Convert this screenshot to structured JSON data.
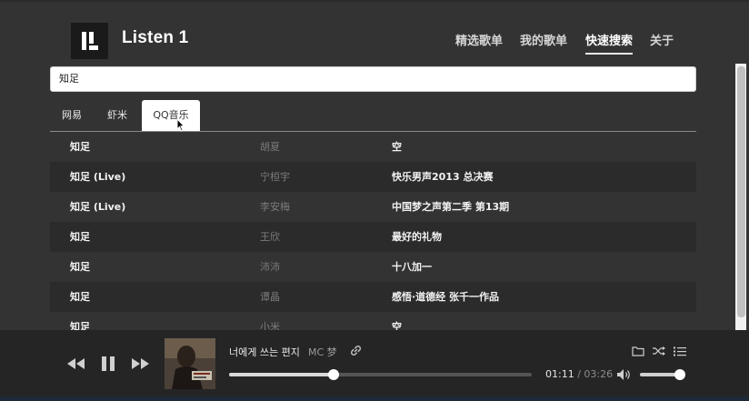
{
  "app": {
    "title": "Listen 1",
    "logo_icon": "listen1-logo-icon"
  },
  "nav": {
    "items": [
      {
        "label": "精选歌单",
        "active": false
      },
      {
        "label": "我的歌单",
        "active": false
      },
      {
        "label": "快速搜索",
        "active": true
      },
      {
        "label": "关于",
        "active": false
      }
    ]
  },
  "search": {
    "value": "知足"
  },
  "source_tabs": [
    {
      "label": "网易",
      "active": false
    },
    {
      "label": "虾米",
      "active": false
    },
    {
      "label": "QQ音乐",
      "active": true
    }
  ],
  "results": [
    {
      "title": "知足",
      "artist": "胡夏",
      "album": "空"
    },
    {
      "title": "知足 (Live)",
      "artist": "宁桓宇",
      "album": "快乐男声2013 总决赛"
    },
    {
      "title": "知足 (Live)",
      "artist": "李安梅",
      "album": "中国梦之声第二季 第13期"
    },
    {
      "title": "知足",
      "artist": "王欣",
      "album": "最好的礼物"
    },
    {
      "title": "知足",
      "artist": "沛沛",
      "album": "十八加一"
    },
    {
      "title": "知足",
      "artist": "谭晶",
      "album": "感悟·道德经 张千一作品"
    },
    {
      "title": "知足",
      "artist": "小米",
      "album": "空"
    }
  ],
  "player": {
    "song_title": "너에게 쓰는 편지",
    "artist": "MC 梦",
    "current_time": "01:11",
    "separator": "/",
    "total_time": "03:26",
    "progress_percent": 34.5,
    "volume_percent": 100,
    "state": "playing",
    "icons": [
      "prev-icon",
      "pause-icon",
      "next-icon",
      "link-icon",
      "folder-icon",
      "shuffle-icon",
      "playlist-icon",
      "volume-icon"
    ]
  },
  "colors": {
    "background": "#333333",
    "row_alt": "#2b2b2b",
    "footer": "#252525",
    "text_muted": "#7b7b7b"
  }
}
